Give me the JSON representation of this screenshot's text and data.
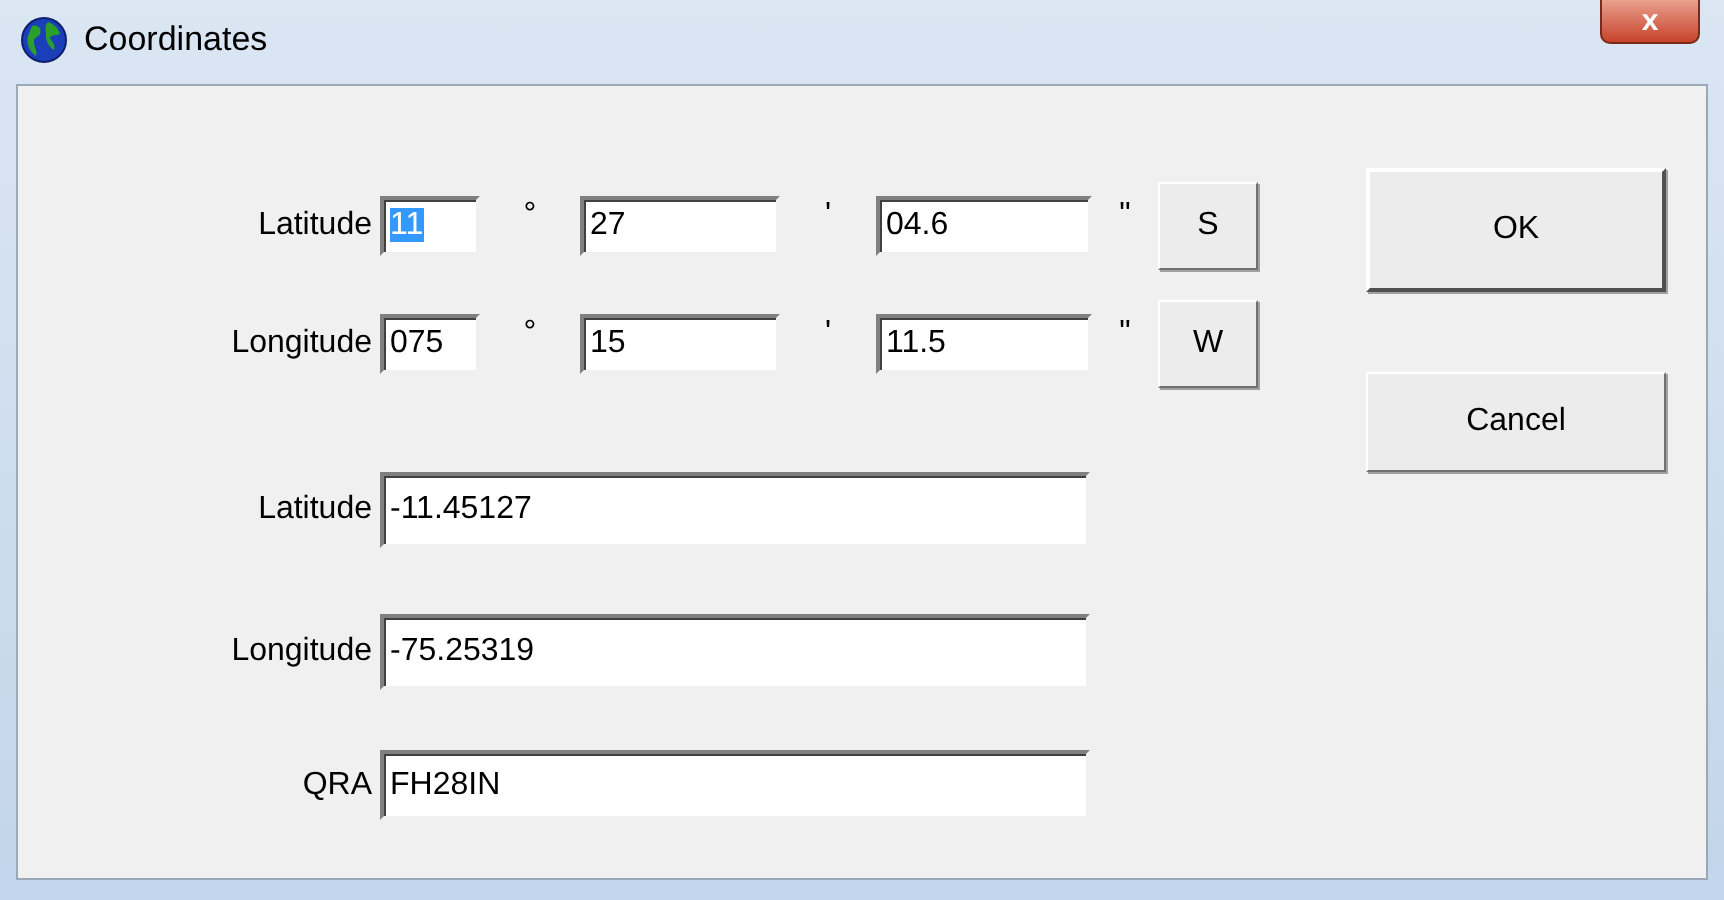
{
  "window": {
    "title": "Coordinates",
    "close": "x"
  },
  "dms_rows": [
    {
      "label": "Latitude",
      "degrees": "11",
      "degrees_selected": true,
      "degree_mark": "°",
      "minutes": "27",
      "minute_mark": "'",
      "seconds": "04.6",
      "second_mark": "\"",
      "hemisphere": "S"
    },
    {
      "label": "Longitude",
      "degrees": "075",
      "degrees_selected": false,
      "degree_mark": "°",
      "minutes": "15",
      "minute_mark": "'",
      "seconds": "11.5",
      "second_mark": "\"",
      "hemisphere": "W"
    }
  ],
  "fields": [
    {
      "label": "Latitude",
      "value": "-11.45127"
    },
    {
      "label": "Longitude",
      "value": "-75.25319"
    },
    {
      "label": "QRA",
      "value": "FH28IN"
    }
  ],
  "buttons": [
    "OK",
    "Cancel"
  ]
}
